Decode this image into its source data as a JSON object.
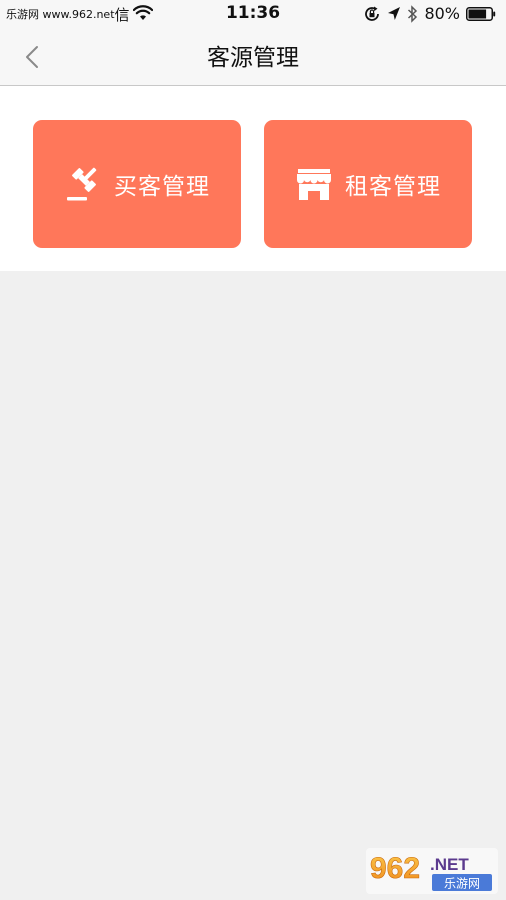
{
  "status_bar": {
    "site_text": "乐游网 www.962.net",
    "carrier_suffix": "信",
    "time": "11:36",
    "battery_percent": "80%",
    "battery_level": 0.8,
    "icons": [
      "wifi-icon",
      "orientation-lock-icon",
      "location-arrow-icon",
      "bluetooth-icon",
      "battery-icon"
    ]
  },
  "nav": {
    "title": "客源管理",
    "back_icon": "chevron-left-icon"
  },
  "tiles": [
    {
      "label": "买客管理",
      "icon": "gavel-icon"
    },
    {
      "label": "租客管理",
      "icon": "storefront-icon"
    }
  ],
  "colors": {
    "tile_background": "#ff775a",
    "page_background": "#f0f0f0"
  },
  "watermark": {
    "brand": "962",
    "suffix": ".NET",
    "subtitle": "乐游网"
  }
}
